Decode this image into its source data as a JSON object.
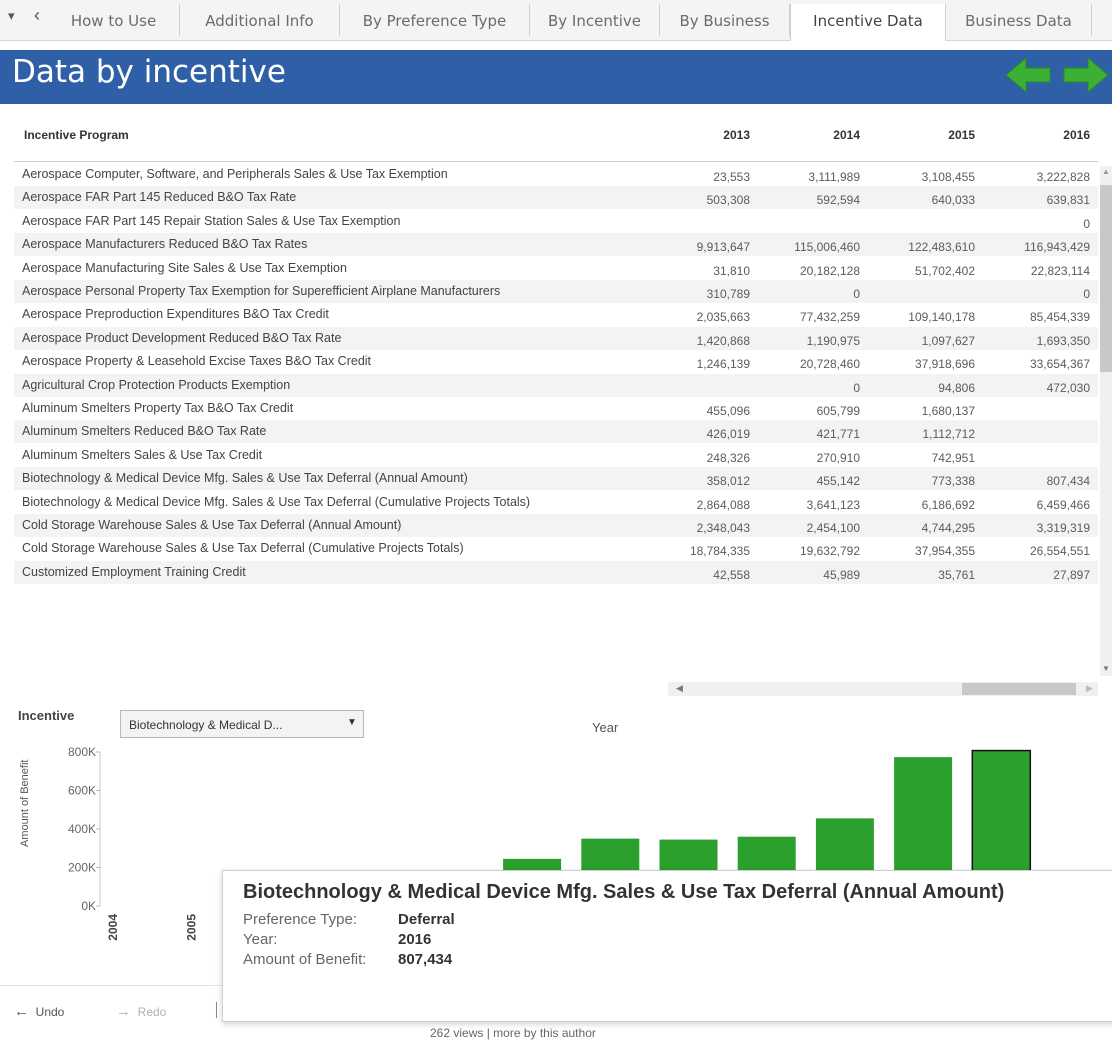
{
  "tabs": {
    "menu_glyph": "▾",
    "back_glyph": "‹",
    "items": [
      {
        "label": "How to Use"
      },
      {
        "label": "Additional Info"
      },
      {
        "label": "By Preference Type"
      },
      {
        "label": "By Incentive"
      },
      {
        "label": "By Business"
      },
      {
        "label": "Incentive Data",
        "active": true
      },
      {
        "label": "Business Data"
      }
    ]
  },
  "header": {
    "title": "Data by incentive",
    "accent": "#2f5fa7",
    "arrow_color": "#3cb034"
  },
  "table": {
    "columns": [
      "Incentive Program",
      "2013",
      "2014",
      "2015",
      "2016"
    ],
    "rows": [
      [
        "Aerospace Computer, Software, and Peripherals Sales & Use Tax Exemption",
        "23,553",
        "3,111,989",
        "3,108,455",
        "3,222,828"
      ],
      [
        "Aerospace FAR Part 145 Reduced B&O Tax Rate",
        "503,308",
        "592,594",
        "640,033",
        "639,831"
      ],
      [
        "Aerospace FAR Part 145 Repair Station Sales & Use Tax Exemption",
        "",
        "",
        "",
        "0"
      ],
      [
        "Aerospace Manufacturers Reduced B&O Tax Rates",
        "9,913,647",
        "115,006,460",
        "122,483,610",
        "116,943,429"
      ],
      [
        "Aerospace Manufacturing Site Sales & Use Tax Exemption",
        "31,810",
        "20,182,128",
        "51,702,402",
        "22,823,114"
      ],
      [
        "Aerospace Personal Property Tax Exemption for Superefficient Airplane Manufacturers",
        "310,789",
        "0",
        "",
        "0"
      ],
      [
        "Aerospace Preproduction Expenditures B&O Tax Credit",
        "2,035,663",
        "77,432,259",
        "109,140,178",
        "85,454,339"
      ],
      [
        "Aerospace Product Development Reduced B&O Tax Rate",
        "1,420,868",
        "1,190,975",
        "1,097,627",
        "1,693,350"
      ],
      [
        "Aerospace Property & Leasehold Excise Taxes B&O Tax Credit",
        "1,246,139",
        "20,728,460",
        "37,918,696",
        "33,654,367"
      ],
      [
        "Agricultural Crop Protection Products Exemption",
        "",
        "0",
        "94,806",
        "472,030"
      ],
      [
        "Aluminum Smelters Property Tax B&O Tax Credit",
        "455,096",
        "605,799",
        "1,680,137",
        ""
      ],
      [
        "Aluminum Smelters Reduced B&O Tax Rate",
        "426,019",
        "421,771",
        "1,112,712",
        ""
      ],
      [
        "Aluminum Smelters Sales & Use Tax Credit",
        "248,326",
        "270,910",
        "742,951",
        ""
      ],
      [
        "Biotechnology & Medical Device Mfg. Sales & Use Tax Deferral (Annual Amount)",
        "358,012",
        "455,142",
        "773,338",
        "807,434"
      ],
      [
        "Biotechnology & Medical Device Mfg. Sales & Use Tax Deferral (Cumulative Projects Totals)",
        "2,864,088",
        "3,641,123",
        "6,186,692",
        "6,459,466"
      ],
      [
        "Cold Storage Warehouse Sales & Use Tax Deferral (Annual Amount)",
        "2,348,043",
        "2,454,100",
        "4,744,295",
        "3,319,319"
      ],
      [
        "Cold Storage Warehouse Sales & Use Tax Deferral (Cumulative Projects Totals)",
        "18,784,335",
        "19,632,792",
        "37,954,355",
        "26,554,551"
      ],
      [
        "Customized Employment Training Credit",
        "42,558",
        "45,989",
        "35,761",
        "27,897"
      ]
    ]
  },
  "filter": {
    "label": "Incentive",
    "selected": "Biotechnology & Medical D...",
    "caret": "▼"
  },
  "chart_data": {
    "type": "bar",
    "xlabel": "Year",
    "ylabel": "Amount of Benefit",
    "ylim": [
      0,
      800000
    ],
    "yticks": [
      {
        "value": 0,
        "label": "0K"
      },
      {
        "value": 200000,
        "label": "200K"
      },
      {
        "value": 400000,
        "label": "400K"
      },
      {
        "value": 600000,
        "label": "600K"
      },
      {
        "value": 800000,
        "label": "800K"
      }
    ],
    "categories": [
      "2004",
      "2005",
      "2006",
      "2007",
      "2008",
      "2009",
      "2010",
      "2011",
      "2012",
      "2013",
      "2014",
      "2015",
      "2016"
    ],
    "visible_category_labels": [
      "2004",
      "2005"
    ],
    "values": [
      0,
      0,
      0,
      180000,
      0,
      245000,
      350000,
      345000,
      360000,
      455142,
      773338,
      807434,
      null
    ],
    "highlighted_index": 11,
    "bar_color": "#2ca02c"
  },
  "tooltip": {
    "title": "Biotechnology & Medical Device Mfg. Sales & Use Tax Deferral (Annual Amount)",
    "rows": [
      {
        "key": "Preference Type:",
        "value": "Deferral"
      },
      {
        "key": "Year:",
        "value": "2016"
      },
      {
        "key": "Amount of Benefit:",
        "value": "807,434"
      }
    ]
  },
  "toolbar": {
    "undo": "Undo",
    "redo": "Redo",
    "undo_glyph": "←",
    "redo_glyph": "→"
  },
  "footer": {
    "text": "262 views | more by this author"
  }
}
